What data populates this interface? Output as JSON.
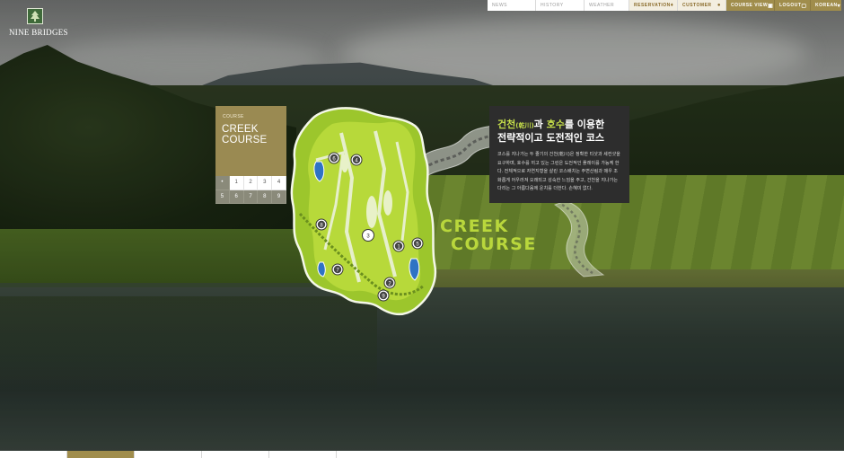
{
  "brand": {
    "logo_text": "NINE BRIDGES"
  },
  "nav": {
    "items": [
      {
        "label": "NEWS",
        "style": "plain"
      },
      {
        "label": "HISTORY",
        "style": "plain"
      },
      {
        "label": "WEATHER",
        "style": "plain"
      },
      {
        "label": "RESERVATION",
        "style": "gold",
        "icon": "lock-icon"
      },
      {
        "label": "CUSTOMER",
        "style": "gold",
        "icon": "person-icon"
      },
      {
        "label": "COURSE VIEW",
        "style": "dark",
        "icon": "map-icon"
      },
      {
        "label": "LOGOUT",
        "style": "dark",
        "icon": "door-icon"
      },
      {
        "label": "KOREAN",
        "style": "dark",
        "icon": "chevron-down-icon"
      }
    ]
  },
  "course_panel": {
    "label": "COURSE",
    "title_line1": "CREEK",
    "title_line2": "COURSE",
    "holes_row1": [
      "•",
      "1",
      "2",
      "3",
      "4"
    ],
    "holes_row2": [
      "5",
      "6",
      "7",
      "8",
      "9"
    ]
  },
  "map": {
    "hole_markers": [
      "1",
      "2",
      "3",
      "4",
      "5",
      "6",
      "7",
      "8",
      "9"
    ],
    "big_title_line1": "CREEK",
    "big_title_line2": "COURSE"
  },
  "info": {
    "headline_part1": "건천",
    "headline_hanja": "(乾川)",
    "headline_part2": "과 ",
    "headline_part3": "호수",
    "headline_part4": "를 이용한",
    "headline_line2": "전략적이고 도전적인 코스",
    "body": "코스를 지나가는 두 줄기의 건천(乾川)은 정확한 티샷과 세컨샷을 요구하며, 호수를 끼고 있는 그린은 도전적인 플레이를 가능케 한다. 전체적으로 자연지형을 살린 코스배치는 주변산림과 매우 조화롭게 어우러져 오래되고 성숙한 느낌을 주고, 건천을 지나가는 다리는 그 아름다움에 운치를 더한다. 손혜미 없다."
  },
  "colors": {
    "accent_gold": "#a08d4c",
    "panel_gold": "#9a8a52",
    "lime": "#b9d73c",
    "info_bg": "#2d2d2d"
  }
}
